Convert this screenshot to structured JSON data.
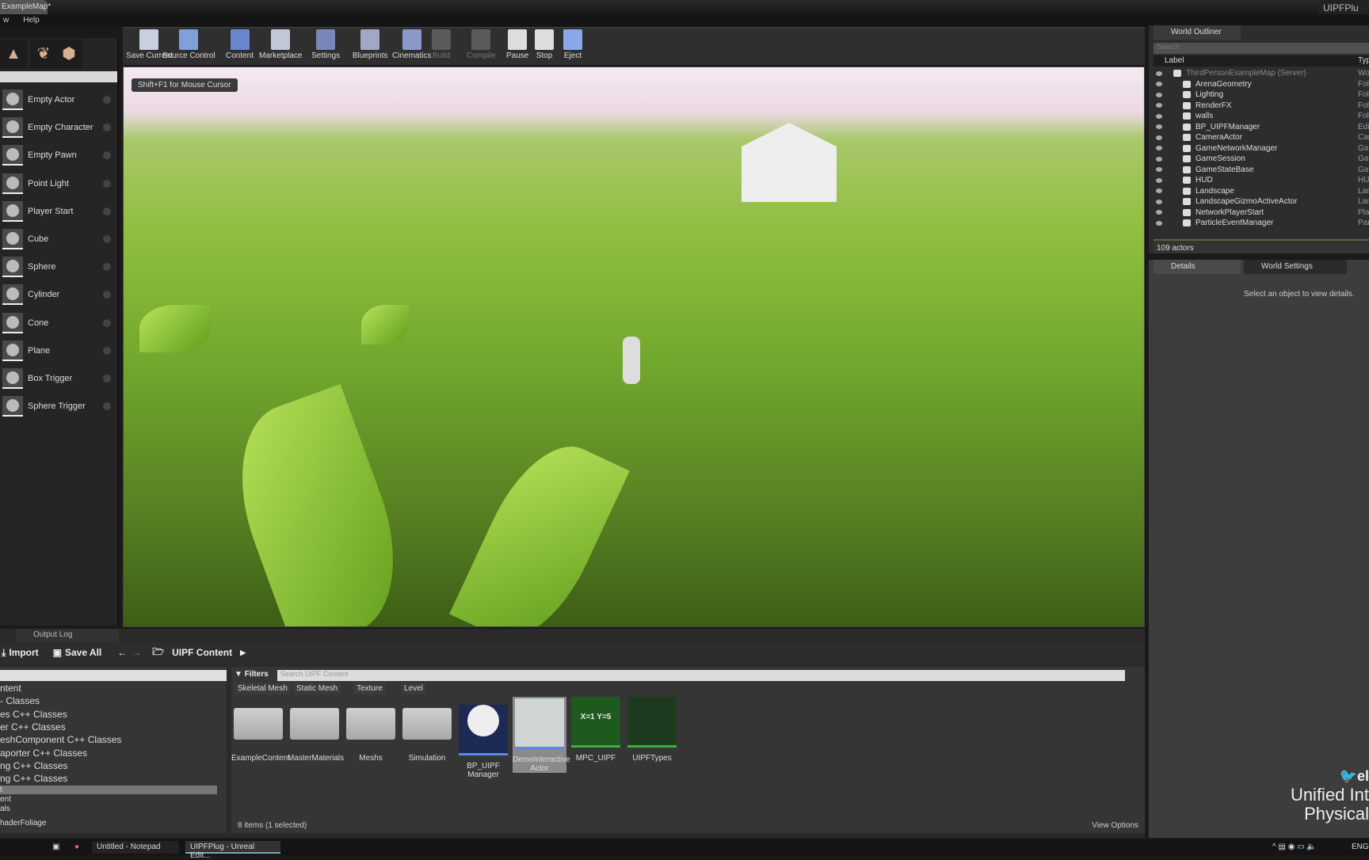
{
  "window": {
    "doc_tab": "ExampleMap*",
    "app_tab": "UIPFPlu"
  },
  "menu": [
    "w",
    "Help"
  ],
  "place_mode": {
    "items": [
      "Empty Actor",
      "Empty Character",
      "Empty Pawn",
      "Point Light",
      "Player Start",
      "Cube",
      "Sphere",
      "Cylinder",
      "Cone",
      "Plane",
      "Box Trigger",
      "Sphere Trigger"
    ]
  },
  "toolbar": [
    {
      "label": "Save Current",
      "icon": "save-icon",
      "color": "#c8d0e0",
      "enabled": true
    },
    {
      "label": "Source Control",
      "icon": "source-control-icon",
      "color": "#7fa0d8",
      "enabled": true
    },
    {
      "label": "Content",
      "icon": "content-icon",
      "color": "#6a86d0",
      "enabled": true
    },
    {
      "label": "Marketplace",
      "icon": "marketplace-icon",
      "color": "#c0c8d8",
      "enabled": true
    },
    {
      "label": "Settings",
      "icon": "settings-icon",
      "color": "#7a86b8",
      "enabled": true
    },
    {
      "label": "Blueprints",
      "icon": "blueprints-icon",
      "color": "#a0a8c8",
      "enabled": true
    },
    {
      "label": "Cinematics",
      "icon": "cinematics-icon",
      "color": "#8a9ac8",
      "enabled": true
    },
    {
      "label": "Build",
      "icon": "build-icon",
      "color": "#5a5a5a",
      "enabled": false
    },
    {
      "label": "Compile",
      "icon": "compile-icon",
      "color": "#5a5a5a",
      "enabled": false
    },
    {
      "label": "Pause",
      "icon": "pause-icon",
      "color": "#dddddd",
      "enabled": true
    },
    {
      "label": "Stop",
      "icon": "stop-icon",
      "color": "#dddddd",
      "enabled": true
    },
    {
      "label": "Eject",
      "icon": "eject-icon",
      "color": "#8aa8e8",
      "enabled": true
    }
  ],
  "viewport": {
    "hint": "Shift+F1 for Mouse Cursor"
  },
  "outliner": {
    "tab": "World Outliner",
    "search_placeholder": "Search",
    "col_label": "Label",
    "col_type": "Typ",
    "rows": [
      {
        "label": "ThirdPersonExampleMap (Server)",
        "type": "Worl"
      },
      {
        "label": "ArenaGeometry",
        "type": "Fold"
      },
      {
        "label": "Lighting",
        "type": "Fold"
      },
      {
        "label": "RenderFX",
        "type": "Fold"
      },
      {
        "label": "walls",
        "type": "Fold"
      },
      {
        "label": "BP_UIPFManager",
        "type": "Edit"
      },
      {
        "label": "CameraActor",
        "type": "Cam"
      },
      {
        "label": "GameNetworkManager",
        "type": "Gam"
      },
      {
        "label": "GameSession",
        "type": "Gam"
      },
      {
        "label": "GameStateBase",
        "type": "Gam"
      },
      {
        "label": "HUD",
        "type": "HUD"
      },
      {
        "label": "Landscape",
        "type": "Land"
      },
      {
        "label": "LandscapeGizmoActiveActor",
        "type": "Land"
      },
      {
        "label": "NetworkPlayerStart",
        "type": "Play"
      },
      {
        "label": "ParticleEventManager",
        "type": "Parti"
      }
    ],
    "count": "109 actors"
  },
  "details": {
    "tab_details": "Details",
    "tab_world": "World Settings",
    "empty_msg": "Select an object to view details."
  },
  "content_browser": {
    "output_log_tab": "Output Log",
    "import": "Import",
    "save_all": "Save All",
    "path": "UIPF Content",
    "tree": [
      "ntent",
      "- Classes",
      "es C++ Classes",
      "er C++ Classes",
      "eshComponent C++ Classes",
      "aporter C++ Classes",
      "ng C++ Classes",
      "ng C++ Classes",
      "t",
      "ent",
      "als",
      "haderFoliage"
    ],
    "filters": "Filters",
    "search_placeholder": "Search UIPF Content",
    "chips": [
      "Skeletal Mesh",
      "Static Mesh",
      "Texture",
      "Level"
    ],
    "assets": [
      {
        "name": "ExampleContent",
        "kind": "folder"
      },
      {
        "name": "MasterMaterials",
        "kind": "folder"
      },
      {
        "name": "Meshs",
        "kind": "folder"
      },
      {
        "name": "Simulation",
        "kind": "folder"
      },
      {
        "name": "BP_UIPF Manager",
        "kind": "blueprint",
        "color": "#1c2a55"
      },
      {
        "name": "DemoInteractive Actor",
        "kind": "blueprint",
        "selected": true,
        "color": "#cfd4d4"
      },
      {
        "name": "MPC_UIPF",
        "kind": "collection",
        "color": "#1e5a1e",
        "glyph": "X=1 Y=5"
      },
      {
        "name": "UIPFTypes",
        "kind": "enum",
        "color": "#1e3a1e"
      }
    ],
    "status": "8 items (1 selected)",
    "view_options": "View Options"
  },
  "overlay": {
    "twitter": "el",
    "line1": "Unified Int",
    "line2": "Physical"
  },
  "taskbar": {
    "items": [
      "Untitled - Notepad",
      "UIPFPlug - Unreal Edit..."
    ],
    "lang": "ENG"
  }
}
